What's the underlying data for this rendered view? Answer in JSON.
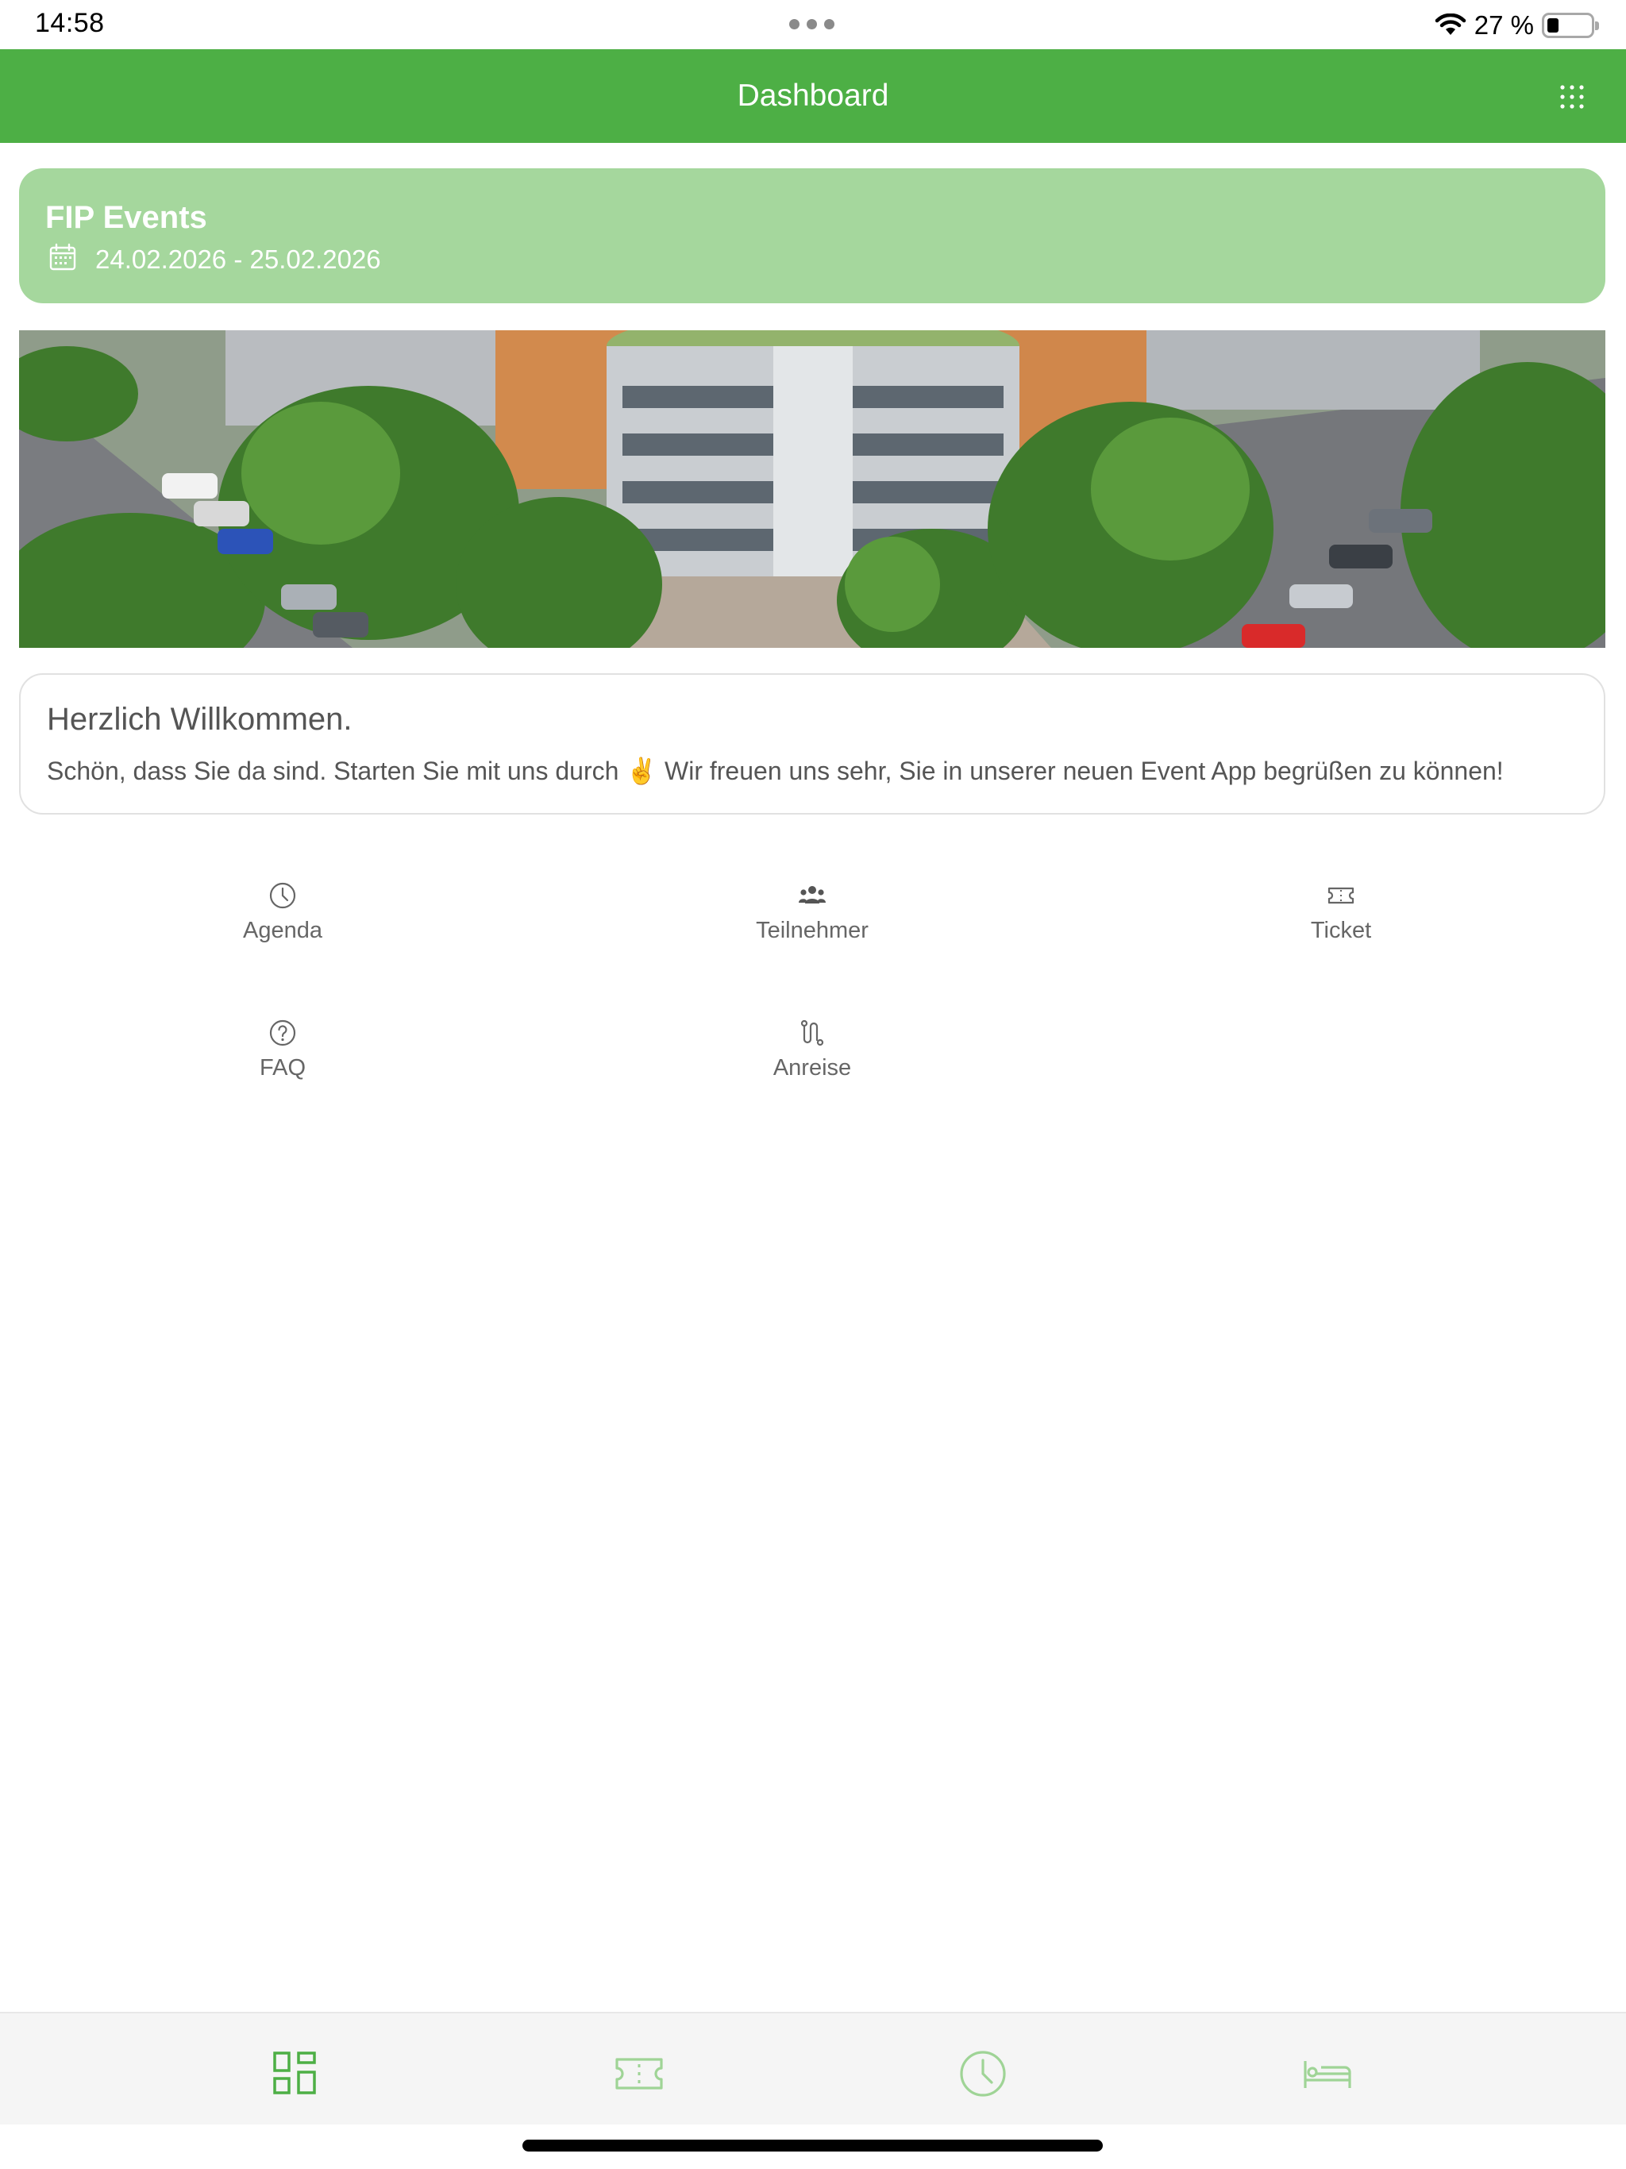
{
  "status_bar": {
    "time": "14:58",
    "battery_percent_label": "27 %",
    "battery_level": 0.27,
    "icons": [
      "multitask-dots-icon",
      "wifi-icon",
      "battery-icon"
    ]
  },
  "header": {
    "title": "Dashboard",
    "menu_icon": "app-grid-icon"
  },
  "event": {
    "title": "FIP Events",
    "dates": "24.02.2026 - 25.02.2026",
    "icon": "calendar-icon"
  },
  "banner": {
    "description_icon": "building-photo"
  },
  "welcome": {
    "title": "Herzlich Willkommen.",
    "text": "Schön, dass Sie da sind. Starten Sie mit uns durch ✌️ Wir freuen uns sehr, Sie in unserer neuen Event App begrüßen zu können!"
  },
  "tiles": [
    {
      "label": "Agenda",
      "icon": "clock-icon"
    },
    {
      "label": "Teilnehmer",
      "icon": "participants-icon"
    },
    {
      "label": "Ticket",
      "icon": "ticket-icon"
    },
    {
      "label": "FAQ",
      "icon": "question-circle-icon"
    },
    {
      "label": "Anreise",
      "icon": "route-icon"
    }
  ],
  "tab_bar": [
    {
      "icon": "dashboard-icon",
      "active": true
    },
    {
      "icon": "ticket-icon",
      "active": false
    },
    {
      "icon": "clock-icon",
      "active": false
    },
    {
      "icon": "bed-icon",
      "active": false
    }
  ],
  "colors": {
    "brand_green": "#4daf45",
    "card_green": "#a5d79d",
    "text_gray": "#555555"
  }
}
